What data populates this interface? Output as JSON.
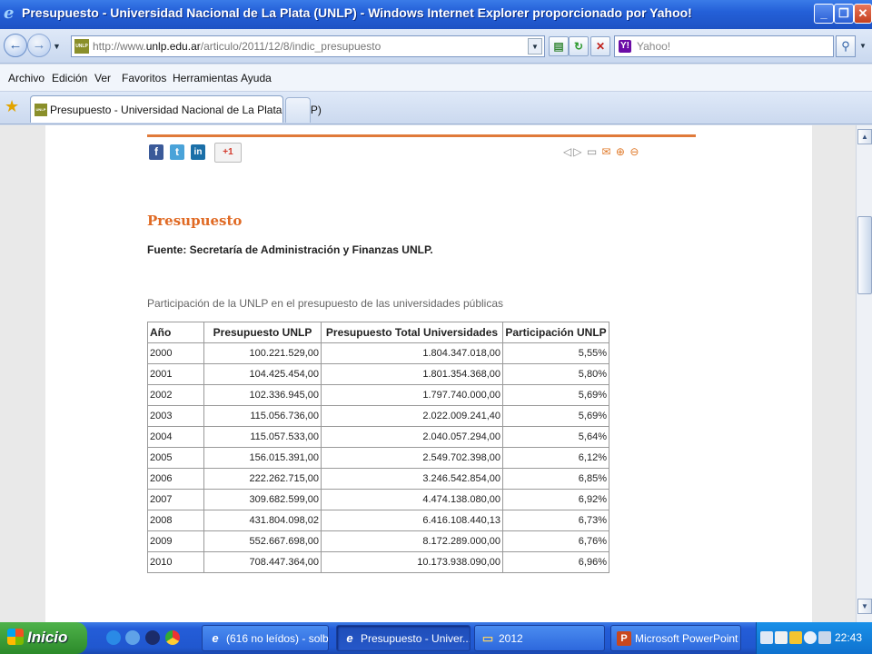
{
  "window": {
    "title": "Presupuesto - Universidad Nacional de La Plata (UNLP) - Windows Internet Explorer proporcionado por Yahoo!",
    "min_glyph": "_",
    "max_glyph": "❐",
    "close_glyph": "✕"
  },
  "address": {
    "favicon_text": "UNLP",
    "url_prefix": "http://www.",
    "url_domain": "unlp.edu.ar",
    "url_path": "/articulo/2011/12/8/indic_presupuesto",
    "search_placeholder": "Yahoo!",
    "yahoo_letter": "Y!"
  },
  "menu": {
    "items": [
      "Archivo",
      "Edición",
      "Ver",
      "Favoritos",
      "Herramientas",
      "Ayuda"
    ]
  },
  "tabs": [
    {
      "label": "Presupuesto - Universidad Nacional de La Plata (UNLP)",
      "favicon_text": "UNLP"
    }
  ],
  "page": {
    "share": {
      "facebook": "f",
      "twitter": "t",
      "linkedin": "in",
      "gplus": "+1"
    },
    "heading": "Presupuesto",
    "source": "Fuente: Secretaría de Administración y Finanzas UNLP.",
    "table_title": "Participación de la UNLP en el presupuesto de las universidades públicas",
    "table": {
      "headers": [
        "Año",
        "Presupuesto UNLP",
        "Presupuesto Total Universidades",
        "Participación UNLP"
      ],
      "rows": [
        [
          "2000",
          "100.221.529,00",
          "1.804.347.018,00",
          "5,55%"
        ],
        [
          "2001",
          "104.425.454,00",
          "1.801.354.368,00",
          "5,80%"
        ],
        [
          "2002",
          "102.336.945,00",
          "1.797.740.000,00",
          "5,69%"
        ],
        [
          "2003",
          "115.056.736,00",
          "2.022.009.241,40",
          "5,69%"
        ],
        [
          "2004",
          "115.057.533,00",
          "2.040.057.294,00",
          "5,64%"
        ],
        [
          "2005",
          "156.015.391,00",
          "2.549.702.398,00",
          "6,12%"
        ],
        [
          "2006",
          "222.262.715,00",
          "3.246.542.854,00",
          "6,85%"
        ],
        [
          "2007",
          "309.682.599,00",
          "4.474.138.080,00",
          "6,92%"
        ],
        [
          "2008",
          "431.804.098,02",
          "6.416.108.440,13",
          "6,73%"
        ],
        [
          "2009",
          "552.667.698,00",
          "8.172.289.000,00",
          "6,76%"
        ],
        [
          "2010",
          "708.447.364,00",
          "10.173.938.090,00",
          "6,96%"
        ]
      ]
    }
  },
  "taskbar": {
    "start_label": "Inicio",
    "items": [
      {
        "label": "(616 no leídos) - solb...",
        "icon": "e"
      },
      {
        "label": "Presupuesto - Univer...",
        "icon": "e"
      },
      {
        "label": "2012",
        "icon": "▭"
      },
      {
        "label": "Microsoft PowerPoint ...",
        "icon": "P"
      }
    ],
    "clock": "22:43"
  },
  "colors": {
    "accent_orange": "#e06a24",
    "titlebar_blue": "#2460d8",
    "taskbar_blue": "#245dd8",
    "start_green": "#3a9e38"
  }
}
